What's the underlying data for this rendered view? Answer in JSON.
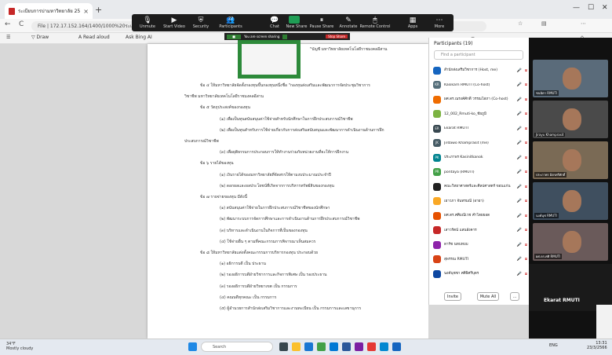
{
  "browser": {
    "tab_title": "ระเบียบการบ่ามหาวิทยาลัย 2566 (4...",
    "new_tab": "+",
    "url": "172.17.152.164/1400/1000%20ระเบียบ/ประกาศ.../ระเบียบ.pdf",
    "back": "←",
    "refresh": "C",
    "info_label": "File",
    "win_min": "—",
    "win_max": "☐",
    "win_close": "✕"
  },
  "pdf_toolbar": {
    "draw": "Draw",
    "read_aloud": "Read aloud",
    "ask_bing": "Ask Bing AI"
  },
  "zoom_toolbar": {
    "items": [
      "Unmute",
      "Start Video",
      "Security",
      "Participants",
      "Chat",
      "New Share",
      "Pause Share",
      "Annotate",
      "Remote Control",
      "Apps",
      "More"
    ],
    "participant_count": "22",
    "sharing_text": "You are screen sharing",
    "stop_share": "Stop Share"
  },
  "document": {
    "lines": [
      "\"บัญชี  มหาวิทยาลัยเทคโนโลยีราชมงคลอีสาน",
      "ข้อ ๔  ให้มหาวิทยาลัยจัดตั้งกองทุนขึ้นกองทุนหนึ่งชื่อ \"กองทุนส่งเสริมและพัฒนาการจัดประชุมวิชาการ",
      "วิชาชีพ มหาวิทยาลัยเทคโนโลยีราชมงคลอีสาน",
      "ข้อ ๕  วัตถุประสงค์ของกองทุน",
      "(๑) เพื่อเป็นทุนสนับสนุนค่าใช้จ่ายสำหรับนักศึกษาในการฝึกประสบการณ์วิชาชีพ",
      "(๒) เพื่อเป็นทุนสำหรับการใช้จ่ายเกี่ยวกับการส่งเสริมสนับสนุนและพัฒนาการดำเนินงานด้านการฝึก",
      "ประสบการณ์วิชาชีพ",
      "(๓) เพื่อยุติธรรมการประกอบการให้ทำงานร่วมกับหน่วยงานที่จะให้การฝึกงาน",
      "ข้อ ๖  รายได้ของทุน",
      "(๑) เงินรายได้ของมหาวิทยาลัยที่จัดสรรให้ตามงบประมาณประจำปี",
      "(๒) ดอกผลและผลประโยชน์ที่เกิดจากการบริหารทรัพย์สินของกองทุน",
      "ข้อ ๗  รายจ่ายของทุน มีดังนี้",
      "(๑) สนับสนุนค่าใช้จ่ายในการฝึกประสบการณ์วิชาชีพของนักศึกษา",
      "(๒) พัฒนาระบบการจัดการศึกษาและการดำเนินงานด้านการฝึกประสบการณ์วิชาชีพ",
      "(๓) บริหารและดำเนินงานในกิจการที่เป็นของกองทุน",
      "(๔) ใช้จ่ายอื่น ๆ ตามที่คณะกรรมการพิจารณาเห็นสมควร",
      "ข้อ ๘  ให้มหาวิทยาลัยแต่งตั้งคณะกรรมการบริหารกองทุน ประกอบด้วย",
      "(๑) อธิการบดี                      เป็น ประธาน",
      "(๒) รองอธิการบดีฝ่ายวิชาการและกิจการพิเศษ     เป็น รองประธาน",
      "(๓) รองอธิการบดีฝ่ายวิทยาเขต                เป็น กรรมการ",
      "(๔) คณบดีทุกคณะ                           เป็น กรรมการ",
      "(๕) ผู้อำนวยการสำนักส่งเสริมวิชาการและงานทะเบียน    เป็น กรรมการและเลขานุการ"
    ]
  },
  "participants": {
    "title": "Participants (19)",
    "search_placeholder": "Find a participant",
    "list": [
      {
        "initials": "",
        "name": "สำนักส่งเสริมวิชาการ (Host, me)",
        "color": "#1565c0"
      },
      {
        "initials": "KR",
        "name": "Kasikarn RMUTI (Co-host)",
        "color": "#546e7a"
      },
      {
        "initials": "",
        "name": "ผศ.ดร.ณรงค์ศักดิ์ วรรณโสภา (Co-host)",
        "color": "#ef6c00"
      },
      {
        "initials": "",
        "name": "12_002_Rmuti-ko_ชัยภูมิ",
        "color": "#7cb342"
      },
      {
        "initials": "ER",
        "name": "Ekarat RMUTI",
        "color": "#37474f"
      },
      {
        "initials": "JK",
        "name": "Jirdawo Khamprasit (me)",
        "color": "#455a64"
      },
      {
        "initials": "PK",
        "name": "ประภาพร Kasinitkanok",
        "color": "#00838f"
      },
      {
        "initials": "PR",
        "name": "pontaya (RMUTI)",
        "color": "#43a047"
      },
      {
        "initials": "",
        "name": "คณะวิทยาศาสตร์และศิลปศาสตร์ ขอนแก่น",
        "color": "#212121"
      },
      {
        "initials": "",
        "name": "เยาวภา จันทรมณี (อายา)",
        "color": "#f9a825"
      },
      {
        "initials": "",
        "name": "ผศ.ดร.ศศิมณีเวช คำโดยยอด",
        "color": "#e65100"
      },
      {
        "initials": "",
        "name": "เสาวรัตน์ แสนอังคาร",
        "color": "#c62828"
      },
      {
        "initials": "",
        "name": "ดารัช นทบทบบ",
        "color": "#8e24aa"
      },
      {
        "initials": "",
        "name": "สุพรรณ RMUTI",
        "color": "#d84315"
      },
      {
        "initials": "",
        "name": "นงค์นุชชา ศศิธิศรีบุตร",
        "color": "#0d47a1"
      }
    ],
    "invite": "Invite",
    "mute_all": "Mute All",
    "more": "..."
  },
  "gallery": {
    "tiles": [
      "ชนนิตา RMUTI",
      "Jirayu Khamprasit",
      "ประภาพร มิตรศรีศักดิ์",
      "นงค์นุช RMUTI",
      "ผศ.ดร.ศศิ RMUTI"
    ],
    "active_speaker": "Ekarat RMUTI"
  },
  "taskbar": {
    "weather_temp": "34°F",
    "weather_desc": "Mostly cloudy",
    "search_placeholder": "Search",
    "lang": "ENG",
    "time": "13:31",
    "date": "23/3/2566"
  },
  "colors": {
    "zoom_green": "#2d8a3a",
    "stop_red": "#c62828",
    "taskbar": "#e4e9f0"
  }
}
